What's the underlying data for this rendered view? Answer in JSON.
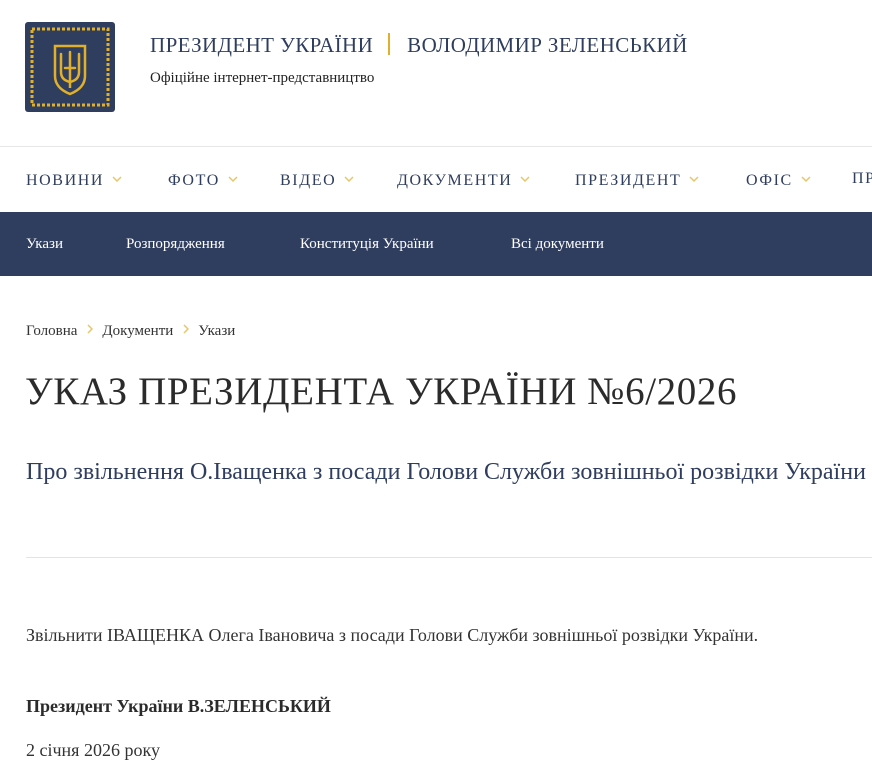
{
  "header": {
    "title_main": "ПРЕЗИДЕНТ УКРАЇНИ",
    "title_name": "ВОЛОДИМИР ЗЕЛЕНСЬКИЙ",
    "subtitle": "Офіційне інтернет-представництво",
    "emblem_icon": "trident-coat-of-arms-icon"
  },
  "main_nav": {
    "items": [
      {
        "label": "НОВИНИ"
      },
      {
        "label": "ФОТО"
      },
      {
        "label": "ВІДЕО"
      },
      {
        "label": "ДОКУМЕНТИ"
      },
      {
        "label": "ПРЕЗИДЕНТ"
      },
      {
        "label": "ОФІС"
      },
      {
        "label": "ПР"
      }
    ],
    "chevron_icon": "chevron-down-icon"
  },
  "sub_nav": {
    "items": [
      {
        "label": "Укази"
      },
      {
        "label": "Розпорядження"
      },
      {
        "label": "Конституція України"
      },
      {
        "label": "Всі документи"
      }
    ]
  },
  "breadcrumb": {
    "items": [
      "Головна",
      "Документи",
      "Укази"
    ],
    "separator_icon": "chevron-right-icon"
  },
  "document": {
    "title": "УКАЗ ПРЕЗИДЕНТА УКРАЇНИ №6/2026",
    "subtitle": "Про звільнення О.Іващенка з посади Голови Служби зовнішньої розвідки України",
    "text": "Звільнити ІВАЩЕНКА Олега Івановича з посади Голови Служби зовнішньої розвідки України.",
    "signature": "Президент України В.ЗЕЛЕНСЬКИЙ",
    "date": "2 січня 2026 року"
  },
  "colors": {
    "brand_navy": "#2f3d5e",
    "accent_gold": "#e0b02b",
    "chevron": "#e8c56a"
  }
}
